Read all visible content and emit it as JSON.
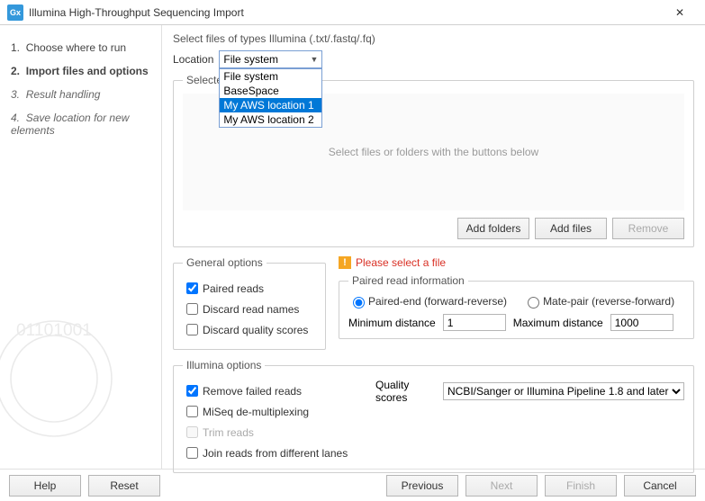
{
  "title": "Illumina High-Throughput Sequencing Import",
  "app_icon": "Gx",
  "steps": [
    "Choose where to run",
    "Import files and options",
    "Result handling",
    "Save location for new elements"
  ],
  "instruction": "Select files of types Illumina (.txt/.fastq/.fq)",
  "location_label": "Location",
  "location_value": "File system",
  "location_options": [
    "File system",
    "BaseSpace",
    "My AWS location 1",
    "My AWS location 2"
  ],
  "selected_legend": "Selected files",
  "file_placeholder": "Select files or folders with the buttons below",
  "btn_add_folders": "Add folders",
  "btn_add_files": "Add files",
  "btn_remove": "Remove",
  "general_legend": "General options",
  "chk_paired": "Paired reads",
  "chk_discard_names": "Discard read names",
  "chk_discard_quality": "Discard quality scores",
  "warning": "Please select a file",
  "paired_legend": "Paired read information",
  "radio_pe": "Paired-end (forward-reverse)",
  "radio_mp": "Mate-pair (reverse-forward)",
  "min_dist_label": "Minimum distance",
  "min_dist_value": "1",
  "max_dist_label": "Maximum distance",
  "max_dist_value": "1000",
  "illumina_legend": "Illumina options",
  "chk_remove_failed": "Remove failed reads",
  "chk_miseq": "MiSeq de-multiplexing",
  "chk_trim": "Trim reads",
  "chk_join": "Join reads from different lanes",
  "quality_label": "Quality scores",
  "quality_value": "NCBI/Sanger or Illumina Pipeline 1.8 and later",
  "btn_help": "Help",
  "btn_reset": "Reset",
  "btn_prev": "Previous",
  "btn_next": "Next",
  "btn_finish": "Finish",
  "btn_cancel": "Cancel"
}
